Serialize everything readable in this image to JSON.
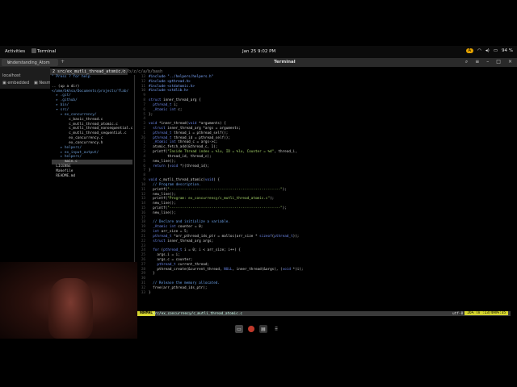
{
  "topbar": {
    "activities": "Activities",
    "app_name": "Terminal",
    "datetime": "Jan 25  9:02 PM",
    "badge": "A",
    "battery": "94 %"
  },
  "window": {
    "tab_label": "Understanding_Atom",
    "title": "Terminal"
  },
  "browser": {
    "row1": "localhost",
    "bookmark": "embedded",
    "bookmark2": "Nesm"
  },
  "tmux": {
    "active_tab": "2 src/ex_mutli_thread_atomic.c",
    "path": "t:/~/b/z/c/a/b/bash"
  },
  "tree": [
    "\" Press ? for help",
    "",
    ".. (up a dir)",
    "</ame/bkhsa/Documents/projects/flab/",
    "  ▸ .git/",
    "  ▸ .github/",
    "  ▸ bin/",
    "  ▾ src/",
    "    ▾ ex_concurrency/",
    "        c_basic_thread.c",
    "        c_mutli_thread_atomic.c",
    "        c_mutli_thread_nonsequential.c",
    "        c_mutli_thread_sequential.c",
    "        ex_concurrency.c",
    "        ex_concurrency.h",
    "    ▸ helpers/",
    "    ▸ ex_input_output/",
    "    ▸ helpers/",
    "      main.c",
    "  LICENSE",
    "  Makefile",
    "  README.md"
  ],
  "editor": {
    "lines": [
      {
        "n": "13",
        "t": "#include \"../helpers/helpers.h\""
      },
      {
        "n": "12",
        "t": "#include <pthread.h>"
      },
      {
        "n": "11",
        "t": "#include <stdatomic.h>"
      },
      {
        "n": "10",
        "t": "#include <stdlib.h>"
      },
      {
        "n": "9",
        "t": ""
      },
      {
        "n": "8",
        "t": "struct inner_thread_arg {"
      },
      {
        "n": "7",
        "t": "  pthread_t i;"
      },
      {
        "n": "6",
        "t": "  _Atomic int c;"
      },
      {
        "n": "5",
        "t": "};"
      },
      {
        "n": "4",
        "t": ""
      },
      {
        "n": "3",
        "t": "void *inner_thread(void *arguments) {"
      },
      {
        "n": "2",
        "t": "  struct inner_thread_arg *args = arguments;"
      },
      {
        "n": "1",
        "t": "  pthread_t thread_i = pthread_self();"
      },
      {
        "n": "26",
        "t": "  pthread_t thread_id = pthread_self();"
      },
      {
        "n": "1",
        "t": "  _Atomic int thread_c = args->c;"
      },
      {
        "n": "2",
        "t": "  atomic_fetch_add(&thread_c, 1);"
      },
      {
        "n": "3",
        "t": "  printf(\"Inside Thread index = %lu, ID = %lu, Counter = %d\", thread_i,"
      },
      {
        "n": "4",
        "t": "         thread_id, thread_c);"
      },
      {
        "n": "5",
        "t": "  new_line();"
      },
      {
        "n": "6",
        "t": "  return (void *)(thread_id);"
      },
      {
        "n": "7",
        "t": "}"
      },
      {
        "n": "8",
        "t": ""
      },
      {
        "n": "9",
        "t": "void c_mutli_thread_atomic(void) {"
      },
      {
        "n": "10",
        "t": "  // Program description."
      },
      {
        "n": "11",
        "t": "  printf(\"-----------------------------------------------------\");"
      },
      {
        "n": "12",
        "t": "  new_line();"
      },
      {
        "n": "13",
        "t": "  printf(\"Program: ex_concurrency/c_mutli_thread_atomic.c\");"
      },
      {
        "n": "14",
        "t": "  new_line();"
      },
      {
        "n": "15",
        "t": "  printf(\"-----------------------------------------------------\");"
      },
      {
        "n": "16",
        "t": "  new_line();"
      },
      {
        "n": "17",
        "t": ""
      },
      {
        "n": "18",
        "t": "  // Declare and initialize a variable."
      },
      {
        "n": "19",
        "t": "  _Atomic int counter = 0;"
      },
      {
        "n": "20",
        "t": "  int arr_size = 5;"
      },
      {
        "n": "21",
        "t": "  pthread_t *arr_pthread_ids_ptr = malloc(arr_size * sizeof(pthread_t));"
      },
      {
        "n": "22",
        "t": "  struct inner_thread_arg args;"
      },
      {
        "n": "23",
        "t": ""
      },
      {
        "n": "24",
        "t": "  for (pthread_t i = 0; i < arr_size; i++) {"
      },
      {
        "n": "25",
        "t": "    args.i = i;"
      },
      {
        "n": "26",
        "t": "    args.c = counter;"
      },
      {
        "n": "27",
        "t": "    pthread_t current_thread;"
      },
      {
        "n": "28",
        "t": "    pthread_create(&current_thread, NULL, inner_thread(&args), (void *)i);"
      },
      {
        "n": "29",
        "t": "  }"
      },
      {
        "n": "30",
        "t": ""
      },
      {
        "n": "31",
        "t": "  // Release the memory allocated."
      },
      {
        "n": "32",
        "t": "  free(arr_pthread_ids_ptr);"
      },
      {
        "n": "33",
        "t": "}"
      }
    ]
  },
  "statusline": {
    "mode": "NORMAL",
    "file": "src/ex_concurrency/c_mutli_thread_atomic.c",
    "encoding": "utf-8",
    "position": "26% ln :13/49≡%:35"
  },
  "dock": [
    "terminal",
    "browser",
    "files",
    "apps"
  ]
}
